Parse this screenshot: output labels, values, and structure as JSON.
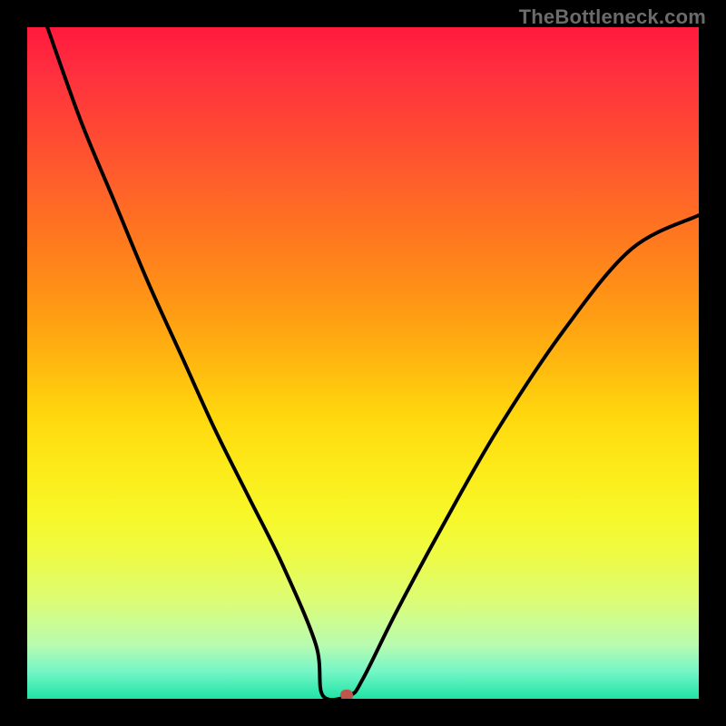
{
  "watermark": "TheBottleneck.com",
  "colors": {
    "frame": "#000000",
    "curve": "#000000",
    "dot": "#c0564b",
    "watermark": "#6b6b6b"
  },
  "chart_data": {
    "type": "line",
    "title": "",
    "xlabel": "",
    "ylabel": "",
    "xlim": [
      0,
      100
    ],
    "ylim": [
      0,
      100
    ],
    "annotations": [
      {
        "type": "marker",
        "x": 47.5,
        "y": 0.5,
        "label": "optimal-point"
      }
    ],
    "series": [
      {
        "name": "bottleneck-curve",
        "x": [
          3,
          8,
          13,
          18,
          23,
          28,
          33,
          38,
          43,
          44,
          48,
          50,
          55,
          62,
          70,
          80,
          90,
          100
        ],
        "y": [
          100,
          86,
          74,
          62,
          51,
          40,
          30,
          20,
          8,
          0.5,
          0.5,
          3,
          13,
          26,
          40,
          55,
          67,
          72
        ]
      }
    ],
    "background_gradient": {
      "orientation": "vertical",
      "stops": [
        {
          "offset": 0.0,
          "color": "#ff1a3c"
        },
        {
          "offset": 0.5,
          "color": "#ffb80f"
        },
        {
          "offset": 0.73,
          "color": "#f7f82a"
        },
        {
          "offset": 1.0,
          "color": "#1fe3a5"
        }
      ]
    }
  }
}
